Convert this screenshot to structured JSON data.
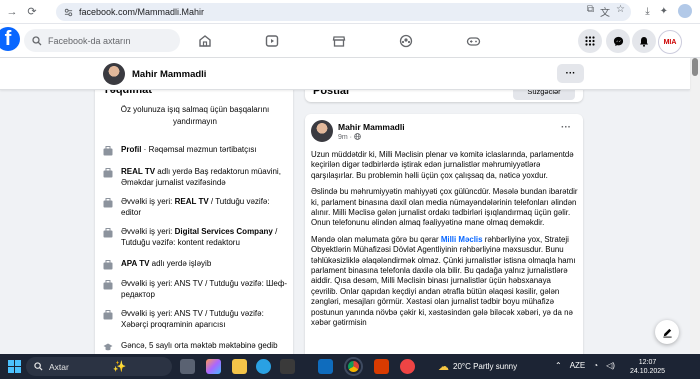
{
  "browser": {
    "url": "facebook.com/Mammadli.Mahir"
  },
  "header": {
    "search_placeholder": "Facebook-da axtarın",
    "page_badge": "MIA"
  },
  "profile": {
    "name": "Mahir Mammadli"
  },
  "intro": {
    "title": "Təqdimat",
    "bio": "Öz yolunuza işıq salmaq üçün başqalarını yandırmayın",
    "items": [
      {
        "icon": "briefcase-icon",
        "bold": "Profil",
        "text": " · Rəqəmsal məzmun tərtibatçısı"
      },
      {
        "icon": "briefcase-icon",
        "bold": "REAL TV",
        "text": " adlı yerdə Baş redaktorun müavini, Əməkdar jurnalist vəzifəsində"
      },
      {
        "icon": "briefcase-icon",
        "prefix": "Əvvəlki iş yeri: ",
        "bold": "REAL TV",
        "text": " / Tutduğu vəzifə: editor"
      },
      {
        "icon": "briefcase-icon",
        "prefix": "Əvvəlki iş yeri: ",
        "bold": "Digital Services Company",
        "text": " / Tutduğu vəzifə: kontent redaktoru"
      },
      {
        "icon": "briefcase-icon",
        "bold": "APA TV",
        "text": " adlı yerdə işləyib"
      },
      {
        "icon": "briefcase-icon",
        "prefix": "Əvvəlki iş yeri: ANS TV / Tutduğu vəzifə: ",
        "bold": "",
        "text": "Шеф-редактор"
      },
      {
        "icon": "briefcase-icon",
        "prefix": "Əvvəlki iş yeri: ANS TV / Tutduğu vəzifə: ",
        "bold": "",
        "text": "Xəbərçi proqraminin aparıcısı"
      },
      {
        "icon": "graduation-cap-icon",
        "prefix": "",
        "bold": "",
        "text": "Gəncə, 5 saylı orta məktəb məktəbinə gedib"
      }
    ]
  },
  "posts": {
    "title": "Postlar",
    "filter_label": "Süzgəclər"
  },
  "post": {
    "author": "Mahir Mammadli",
    "time": "9m ·",
    "paragraphs": [
      "Uzun müddətdir ki, Milli Məclisin plenar və komitə iclaslarında, parlamentdə keçirilən digər tədbirlərdə iştirak edən jurnalistlər məhrumiyyətlərə qarşılaşırlar. Bu problemin həlli üçün çox çalışsaq da, nəticə yoxdur.",
      "Əslində bu məhrumiyyətin mahiyyəti çox gülüncdür. Məsələ bundan ibarətdir ki, parlament binasına daxil olan media nümayəndələrinin telefonları əlindən alınır. Milli Məclisə gələn jurnalist ordakı tədbirləri işıqlandırmaq üçün gəlir. Onun telefonunu əlindən almaq fəaliyyətinə mane olmaq deməkdir."
    ],
    "p3_before": "Məndə olan məlumata görə bu qərar ",
    "p3_mention": "Milli Məclis",
    "p3_after": " rəhbərliyinə yox, Strateji Obyektlərin Mühafizəsi Dövlət Agentliyinin rəhbərliyinə məxsusdur. Bunu təhlükəsizliklə əlaqələndirmək olmaz. Çünki jurnalistlər istisna olmaqla hamı parlament binasına telefonla daxilə ola bilir. Bu qadağa yalnız jurnalistlərə aiddir. Qısa desəm, Milli Məclisin binası jurnalistlər üçün həbsxanaya çevrilib. Onlar qapıdan keçdiyi andan ətrafla bütün əlaqəsi kəsilir, gələn zəngləri, mesajları görmür. Xəstəsi olan jurnalist tədbir boyu mühafizə postunun yanında növbə çəkir ki, xəstəsindən gələ biləcək xəbəri, yə da nə xəbər gətirmisin"
  },
  "taskbar": {
    "search_label": "Axtar",
    "weather": "20°C  Partly sunny",
    "lang": "AZE",
    "time": "12:07",
    "date": "24.10.2025"
  },
  "colors": {
    "fb_blue": "#0866ff",
    "taskbar": "#1c2434"
  }
}
